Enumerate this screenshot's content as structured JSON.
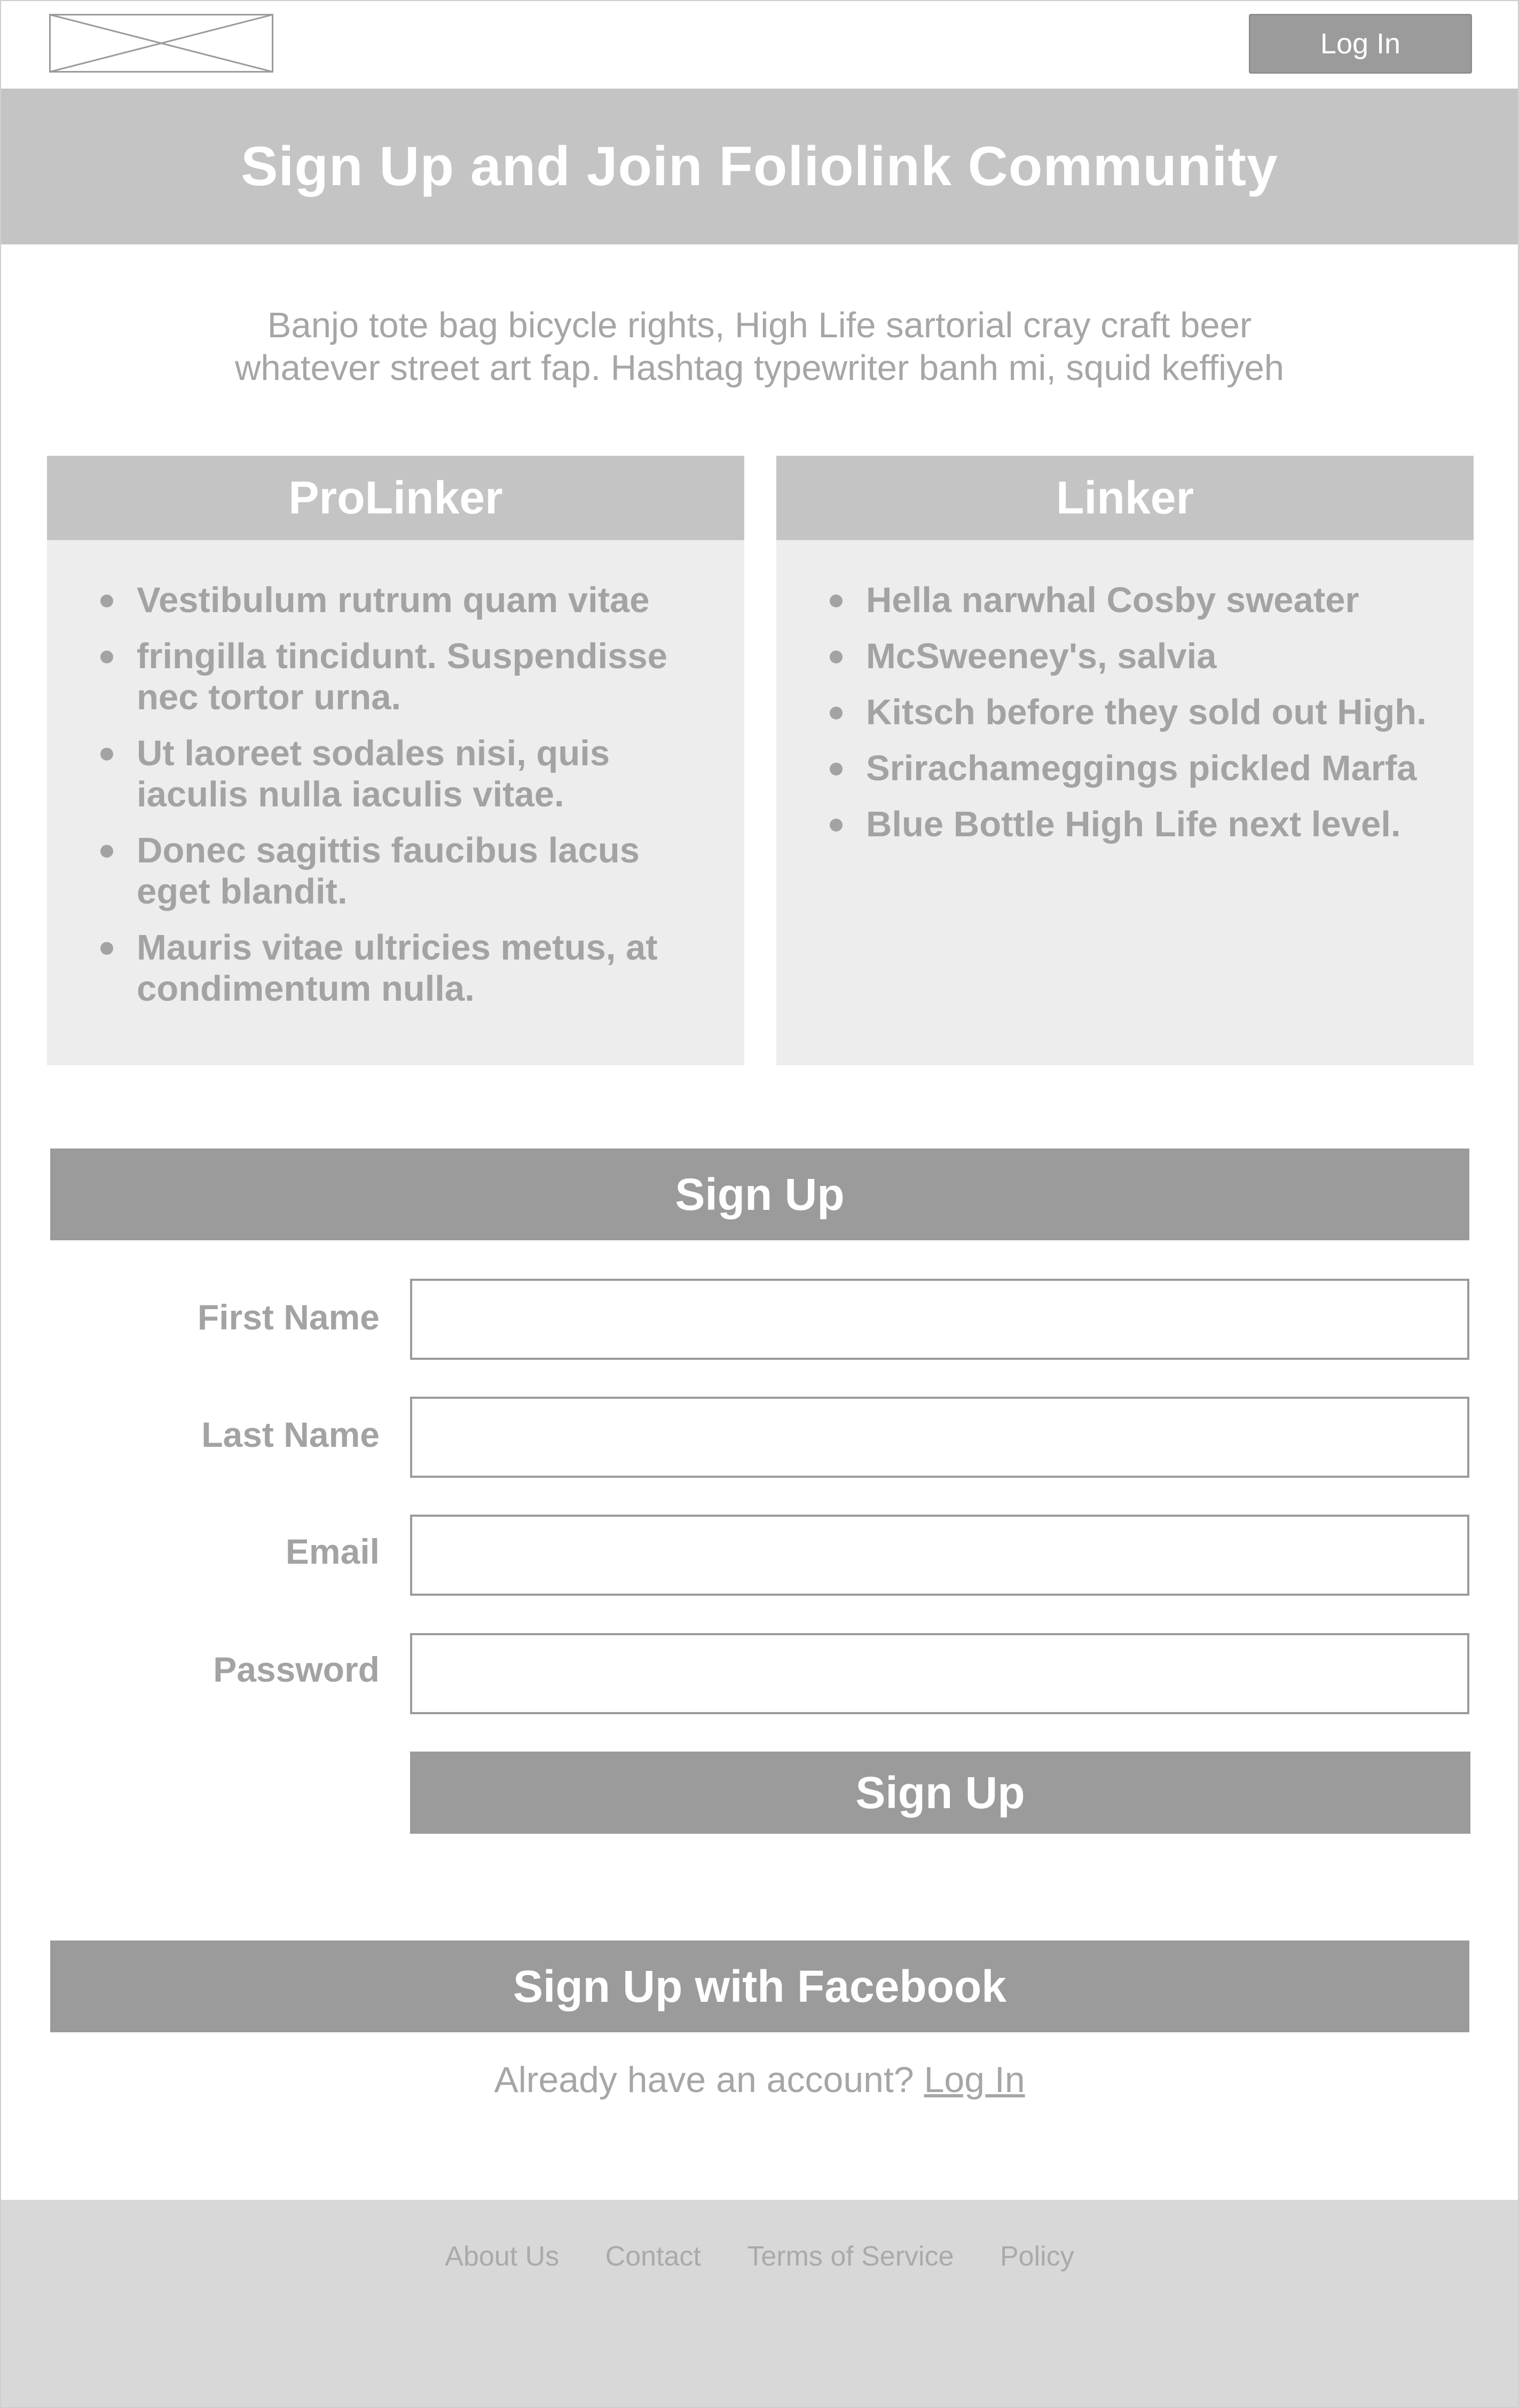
{
  "header": {
    "logo_icon": "image-placeholder-icon",
    "login_label": "Log In"
  },
  "hero": {
    "title": "Sign Up and Join Foliolink Community"
  },
  "intro": {
    "line1": "Banjo tote bag bicycle rights, High Life sartorial cray craft beer",
    "line2": "whatever street art fap. Hashtag typewriter banh mi, squid keffiyeh"
  },
  "plans": [
    {
      "title": "ProLinker",
      "items": [
        "Vestibulum rutrum quam vitae",
        "fringilla tincidunt. Suspendisse nec tortor urna.",
        "Ut laoreet sodales nisi, quis iaculis nulla iaculis vitae.",
        "Donec sagittis faucibus lacus eget blandit.",
        "Mauris vitae ultricies metus, at condimentum nulla."
      ]
    },
    {
      "title": "Linker",
      "items": [
        "Hella narwhal Cosby sweater",
        "McSweeney's, salvia",
        "Kitsch before they sold out High.",
        "Srirachameggings pickled Marfa",
        "Blue Bottle High Life next level."
      ]
    }
  ],
  "signup": {
    "heading": "Sign Up",
    "fields": [
      {
        "label": "First Name",
        "value": ""
      },
      {
        "label": "Last Name",
        "value": ""
      },
      {
        "label": "Email",
        "value": ""
      },
      {
        "label": "Password",
        "value": ""
      }
    ],
    "submit_label": "Sign Up",
    "facebook_label": "Sign Up with Facebook",
    "already_text": "Already have an account?",
    "login_link": "Log In"
  },
  "footer": {
    "links": [
      "About Us",
      "Contact",
      "Terms of Service",
      "Policy"
    ]
  },
  "colors": {
    "hero_bg": "#c4c4c4",
    "button_bg": "#9b9b9b",
    "panel_bg": "#ededed",
    "footer_bg": "#d8d8d8",
    "text_gray": "#a3a3a3"
  }
}
